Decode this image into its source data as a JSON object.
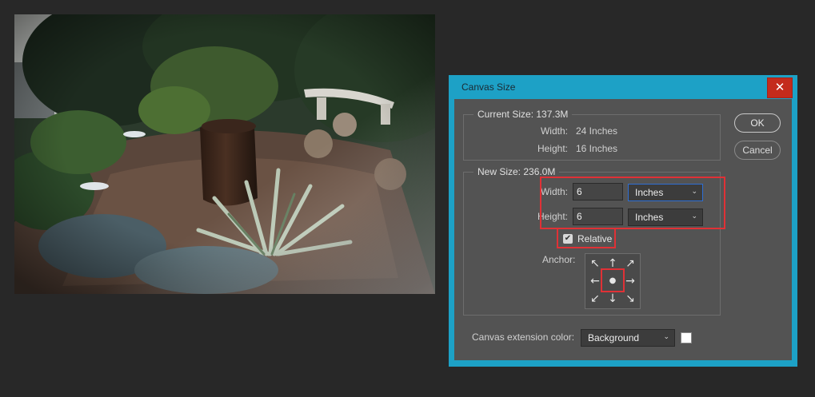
{
  "dialog": {
    "title": "Canvas Size",
    "close_symbol": "✕",
    "current_size": {
      "title": "Current Size: 137.3M",
      "width_label": "Width:",
      "width_value": "24 Inches",
      "height_label": "Height:",
      "height_value": "16 Inches"
    },
    "new_size": {
      "title": "New Size: 236.0M",
      "width_label": "Width:",
      "width_value": "6",
      "width_unit": "Inches",
      "height_label": "Height:",
      "height_value": "6",
      "height_unit": "Inches",
      "relative_label": "Relative",
      "relative_checked": true,
      "anchor_label": "Anchor:",
      "anchor_arrows": [
        "↖",
        "↑",
        "↗",
        "←",
        "●",
        "→",
        "↙",
        "↓",
        "↘"
      ]
    },
    "extension_color": {
      "label": "Canvas extension color:",
      "value": "Background",
      "swatch_color": "#ffffff"
    },
    "ok_label": "OK",
    "cancel_label": "Cancel"
  },
  "colors": {
    "dialog_frame": "#1da1c6",
    "dialog_body": "#535353",
    "close_button": "#c42b1c",
    "highlight": "#e03136"
  },
  "icons": {
    "close": "close-icon",
    "dropdown": "chevron-down-icon",
    "check": "checkmark-icon"
  }
}
